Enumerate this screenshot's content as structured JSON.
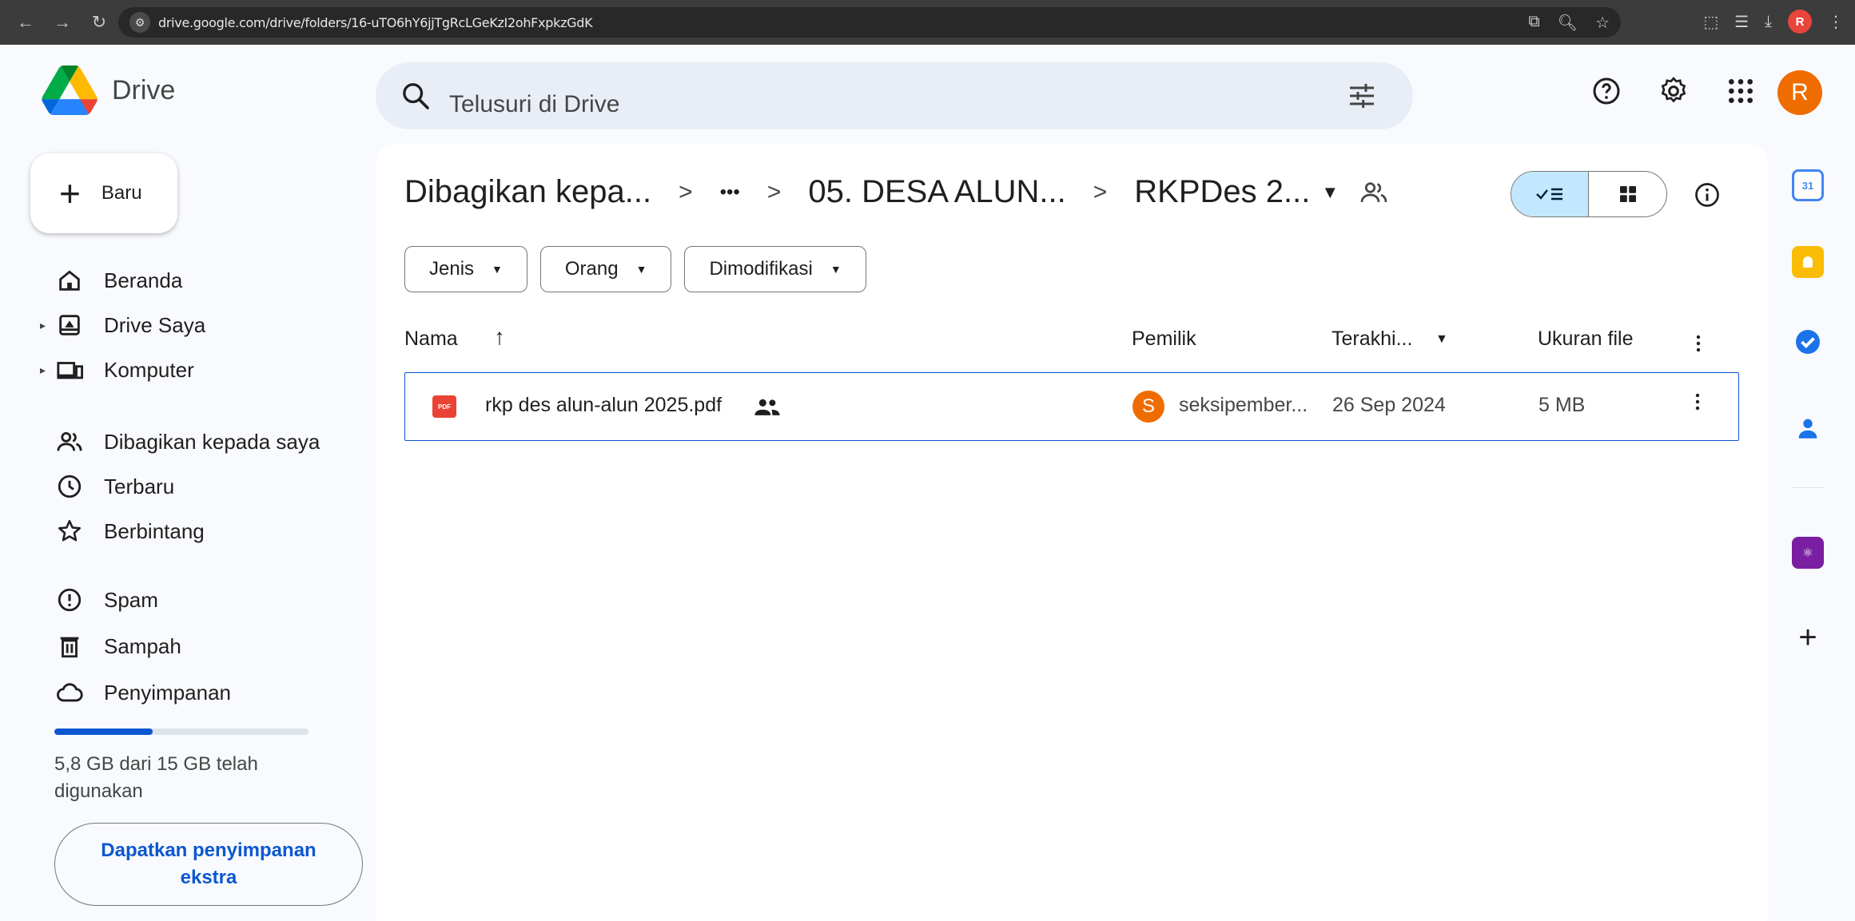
{
  "browser": {
    "url": "drive.google.com/drive/folders/16-uTO6hY6jjTgRcLGeKzI2ohFxpkzGdK",
    "profile_initial": "R"
  },
  "app": {
    "name": "Drive"
  },
  "search": {
    "placeholder": "Telusuri di Drive"
  },
  "user": {
    "avatar_initial": "R"
  },
  "sidebar": {
    "new_label": "Baru",
    "items": [
      {
        "label": "Beranda"
      },
      {
        "label": "Drive Saya"
      },
      {
        "label": "Komputer"
      },
      {
        "label": "Dibagikan kepada saya"
      },
      {
        "label": "Terbaru"
      },
      {
        "label": "Berbintang"
      },
      {
        "label": "Spam"
      },
      {
        "label": "Sampah"
      },
      {
        "label": "Penyimpanan"
      }
    ],
    "storage": {
      "used_fraction": 0.387,
      "text": "5,8 GB dari 15 GB telah digunakan",
      "cta": "Dapatkan penyimpanan ekstra"
    }
  },
  "breadcrumb": {
    "root": "Dibagikan kepa...",
    "ellipsis": "•••",
    "parent": "05. DESA ALUN...",
    "current": "RKPDes 2..."
  },
  "filters": [
    {
      "label": "Jenis"
    },
    {
      "label": "Orang"
    },
    {
      "label": "Dimodifikasi"
    }
  ],
  "table": {
    "columns": {
      "name": "Nama",
      "owner": "Pemilik",
      "modified": "Terakhi...",
      "size": "Ukuran file"
    },
    "rows": [
      {
        "file_type": "PDF",
        "name": "rkp des alun-alun 2025.pdf",
        "owner_initial": "S",
        "owner": "seksipember...",
        "modified": "26 Sep 2024",
        "size": "5 MB"
      }
    ]
  },
  "side_panel": {
    "calendar_day": "31"
  },
  "colors": {
    "accent": "#0b57d0",
    "selected_bg": "#c2e7ff",
    "avatar": "#ef6c00",
    "pdf_red": "#ea4335"
  }
}
